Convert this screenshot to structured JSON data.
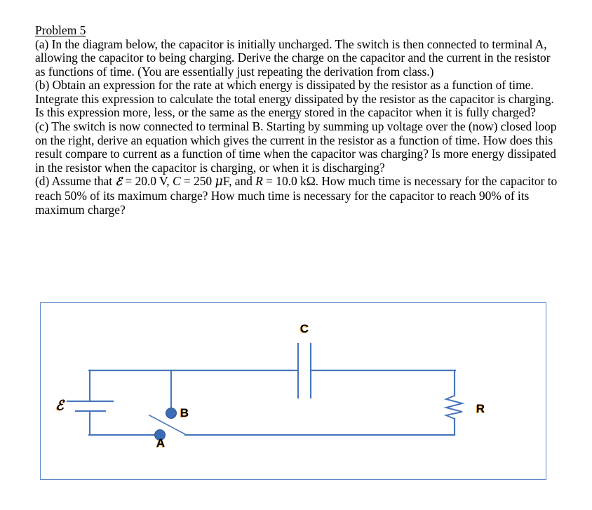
{
  "document": {
    "heading": "Problem 5",
    "parts": [
      {
        "id": "part-a",
        "text": "(a) In the diagram below, the capacitor is initially uncharged.  The switch is then connected to terminal A, allowing the capacitor to being charging.  Derive the charge on the capacitor and the current in the resistor as functions of time.  (You are essentially just repeating the derivation from class.)"
      },
      {
        "id": "part-b",
        "text": "(b) Obtain an expression for the rate at which energy is dissipated by the resistor as a function of time.  Integrate this expression to calculate the total energy dissipated by the resistor as the capacitor is charging.  Is this expression more, less, or the same as the energy stored in the capacitor when it is fully charged?"
      },
      {
        "id": "part-c",
        "text": "(c) The switch is now connected to terminal B.  Starting by summing up voltage over the (now) closed loop on the right, derive an equation which gives the current in the resistor as a function of time.  How does this result compare to current as a function of time when the capacitor was charging?  Is more energy dissipated in the resistor when the capacitor is charging, or when it is discharging?"
      }
    ],
    "part_d": {
      "id": "part-d",
      "prefix": "(d) Assume that ",
      "emf_symbol": "ℰ",
      "emf_value": " = 20.0 V, ",
      "c_symbol": "C",
      "c_value": " = 250 ",
      "mu_symbol": "μ",
      "c_unit": "F, and ",
      "r_symbol": "R",
      "r_value": " = 10.0 kΩ.  How much time is necessary for the capacitor to reach 50% of its maximum charge?  How much time is necessary for the capacitor to reach 90% of its maximum charge?"
    }
  },
  "circuit": {
    "labels": {
      "emf": "ℰ",
      "capacitor": "C",
      "resistor": "R",
      "terminal_a": "A",
      "terminal_b": "B"
    },
    "colors": {
      "wire": "#4a76bd",
      "border": "#5b89c9",
      "node_fill": "#3b6cb5",
      "node_stroke": "#2e5591",
      "label_shadow": "#e8a33d",
      "label_text": "#000000"
    }
  }
}
